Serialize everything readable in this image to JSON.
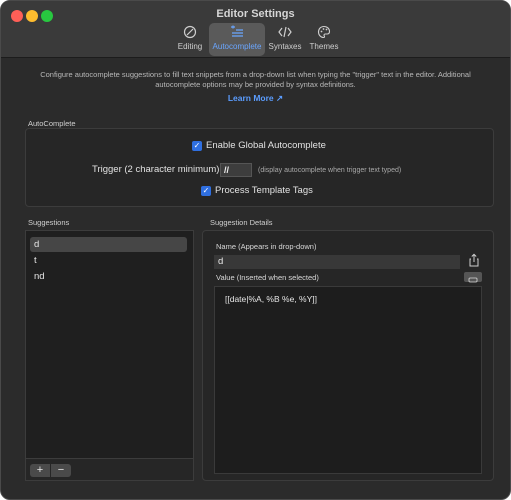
{
  "window": {
    "title": "Editor Settings"
  },
  "toolbar": {
    "tabs": [
      {
        "label": "Editing",
        "icon": "circle-slash-icon"
      },
      {
        "label": "Autocomplete",
        "icon": "list-plus-icon"
      },
      {
        "label": "Syntaxes",
        "icon": "code-brackets-icon"
      },
      {
        "label": "Themes",
        "icon": "palette-icon"
      }
    ],
    "active": "Autocomplete"
  },
  "intro": {
    "text": "Configure autocomplete suggestions to fill text snippets from a drop-down list when typing the \"trigger\" text in the editor. Additional autocomplete options may be provided by syntax definitions.",
    "learn_more": "Learn More ↗"
  },
  "autocomplete": {
    "section_title": "AutoComplete",
    "enable_label": "Enable Global Autocomplete",
    "enable_checked": true,
    "trigger_label": "Trigger (2 character minimum)",
    "trigger_value": "//",
    "trigger_hint": "(display autocomplete when trigger text typed)",
    "process_label": "Process Template Tags",
    "process_checked": true
  },
  "suggestions": {
    "section_title": "Suggestions",
    "items": [
      "d",
      "t",
      "nd"
    ],
    "selected": "d",
    "add_label": "+",
    "remove_label": "−"
  },
  "details": {
    "section_title": "Suggestion Details",
    "name_label": "Name (Appears in drop-down)",
    "name_value": "d",
    "value_label": "Value (Inserted when selected)",
    "value_text": "[[date|%A, %B %e, %Y]]"
  },
  "colors": {
    "accent": "#2f6fe0",
    "link": "#5b9dff",
    "window_bg": "#2b2b2b"
  }
}
